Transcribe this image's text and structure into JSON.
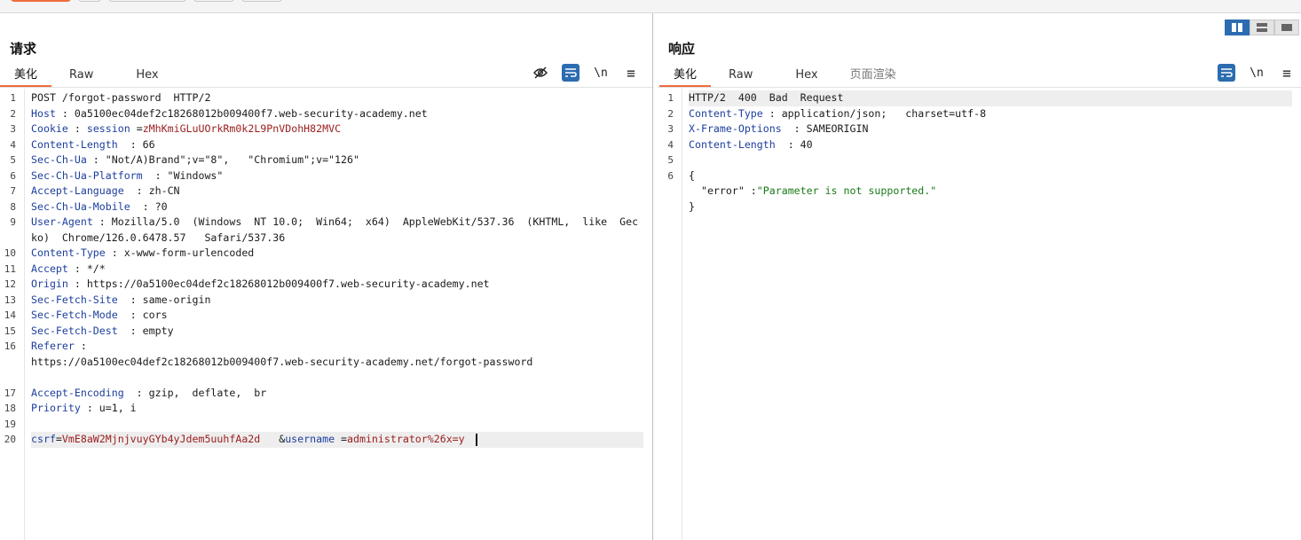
{
  "request": {
    "title": "请求",
    "tabs": [
      "美化",
      "Raw",
      "Hex"
    ],
    "icons": [
      "eye-slash-icon",
      "wrap-icon",
      "newline-icon",
      "menu-icon"
    ],
    "newline_label": "\\n",
    "menu_label": "≡",
    "lines": [
      {
        "num": "1",
        "parts": [
          {
            "t": "POST /forgot-password  HTTP/2",
            "c": ""
          }
        ]
      },
      {
        "num": "2",
        "parts": [
          {
            "t": "Host",
            "c": "k"
          },
          {
            "t": " : 0a5100ec04def2c18268012b009400f7.web-security-academy.net",
            "c": ""
          }
        ]
      },
      {
        "num": "3",
        "parts": [
          {
            "t": "Cookie",
            "c": "k"
          },
          {
            "t": " : ",
            "c": ""
          },
          {
            "t": "session",
            "c": "k"
          },
          {
            "t": " =",
            "c": ""
          },
          {
            "t": "zMhKmiGLuUOrkRm0k2L9PnVDohH82MVC",
            "c": "v"
          }
        ]
      },
      {
        "num": "4",
        "parts": [
          {
            "t": "Content-Length",
            "c": "k"
          },
          {
            "t": "  : 66",
            "c": ""
          }
        ]
      },
      {
        "num": "5",
        "parts": [
          {
            "t": "Sec-Ch-Ua",
            "c": "k"
          },
          {
            "t": " : \"Not/A)Brand\";v=\"8\",   \"Chromium\";v=\"126\"",
            "c": ""
          }
        ]
      },
      {
        "num": "6",
        "parts": [
          {
            "t": "Sec-Ch-Ua-Platform",
            "c": "k"
          },
          {
            "t": "  : \"Windows\"",
            "c": ""
          }
        ]
      },
      {
        "num": "7",
        "parts": [
          {
            "t": "Accept-Language",
            "c": "k"
          },
          {
            "t": "  : zh-CN",
            "c": ""
          }
        ]
      },
      {
        "num": "8",
        "parts": [
          {
            "t": "Sec-Ch-Ua-Mobile",
            "c": "k"
          },
          {
            "t": "  : ?0",
            "c": ""
          }
        ]
      },
      {
        "num": "9",
        "parts": [
          {
            "t": "User-Agent",
            "c": "k"
          },
          {
            "t": " : Mozilla/5.0  (Windows  NT 10.0;  Win64;  x64)  AppleWebKit/537.36  (KHTML,  like  Gecko)  Chrome/126.0.6478.57   Safari/537.36",
            "c": ""
          }
        ],
        "tall": "tall"
      },
      {
        "num": "10",
        "parts": [
          {
            "t": "Content-Type",
            "c": "k"
          },
          {
            "t": " : x-www-form-urlencoded",
            "c": ""
          }
        ]
      },
      {
        "num": "11",
        "parts": [
          {
            "t": "Accept",
            "c": "k"
          },
          {
            "t": " : */*",
            "c": ""
          }
        ]
      },
      {
        "num": "12",
        "parts": [
          {
            "t": "Origin",
            "c": "k"
          },
          {
            "t": " : https://0a5100ec04def2c18268012b009400f7.web-security-academy.net",
            "c": ""
          }
        ]
      },
      {
        "num": "13",
        "parts": [
          {
            "t": "Sec-Fetch-Site",
            "c": "k"
          },
          {
            "t": "  : same-origin",
            "c": ""
          }
        ]
      },
      {
        "num": "14",
        "parts": [
          {
            "t": "Sec-Fetch-Mode",
            "c": "k"
          },
          {
            "t": "  : cors",
            "c": ""
          }
        ]
      },
      {
        "num": "15",
        "parts": [
          {
            "t": "Sec-Fetch-Dest",
            "c": "k"
          },
          {
            "t": "  : empty",
            "c": ""
          }
        ]
      },
      {
        "num": "16",
        "parts": [
          {
            "t": "Referer",
            "c": "k"
          },
          {
            "t": " :\nhttps://0a5100ec04def2c18268012b009400f7.web-security-academy.net/forgot-password",
            "c": ""
          }
        ],
        "tall": "xtall"
      },
      {
        "num": "17",
        "parts": [
          {
            "t": "Accept-Encoding",
            "c": "k"
          },
          {
            "t": "  : gzip,  deflate,  br",
            "c": ""
          }
        ]
      },
      {
        "num": "18",
        "parts": [
          {
            "t": "Priority",
            "c": "k"
          },
          {
            "t": " : u=1, i",
            "c": ""
          }
        ]
      },
      {
        "num": "19",
        "parts": [
          {
            "t": "",
            "c": ""
          }
        ]
      },
      {
        "num": "20",
        "parts": [
          {
            "t": "csrf",
            "c": "k"
          },
          {
            "t": "=",
            "c": ""
          },
          {
            "t": "VmE8aW2MjnjvuyGYb4yJdem5uuhfAa2d",
            "c": "v"
          },
          {
            "t": "   &",
            "c": ""
          },
          {
            "t": "username",
            "c": "k"
          },
          {
            "t": " =",
            "c": ""
          },
          {
            "t": "administrator%26x=y",
            "c": "v"
          }
        ],
        "hl": true,
        "cursor": true
      }
    ]
  },
  "response": {
    "title": "响应",
    "tabs": [
      "美化",
      "Raw",
      "Hex",
      "页面渲染"
    ],
    "icons": [
      "wrap-icon",
      "newline-icon",
      "menu-icon"
    ],
    "newline_label": "\\n",
    "menu_label": "≡",
    "lines": [
      {
        "num": "1",
        "parts": [
          {
            "t": "HTTP/2  400  Bad  Request",
            "c": ""
          }
        ],
        "hl": true
      },
      {
        "num": "2",
        "parts": [
          {
            "t": "Content-Type",
            "c": "k"
          },
          {
            "t": " : application/json;   charset=utf-8",
            "c": ""
          }
        ]
      },
      {
        "num": "3",
        "parts": [
          {
            "t": "X-Frame-Options",
            "c": "k"
          },
          {
            "t": "  : SAMEORIGIN",
            "c": ""
          }
        ]
      },
      {
        "num": "4",
        "parts": [
          {
            "t": "Content-Length",
            "c": "k"
          },
          {
            "t": "  : 40",
            "c": ""
          }
        ]
      },
      {
        "num": "5",
        "parts": [
          {
            "t": "",
            "c": ""
          }
        ]
      },
      {
        "num": "6",
        "parts": [
          {
            "t": "{\n  \"error\" :",
            "c": ""
          },
          {
            "t": "\"Parameter is not supported.\"",
            "c": "s"
          },
          {
            "t": "\n}",
            "c": ""
          }
        ],
        "tall": "xtall"
      }
    ]
  },
  "colors": {
    "accent": "#ef6d3c",
    "toggle_blue": "#2c6cb0"
  }
}
